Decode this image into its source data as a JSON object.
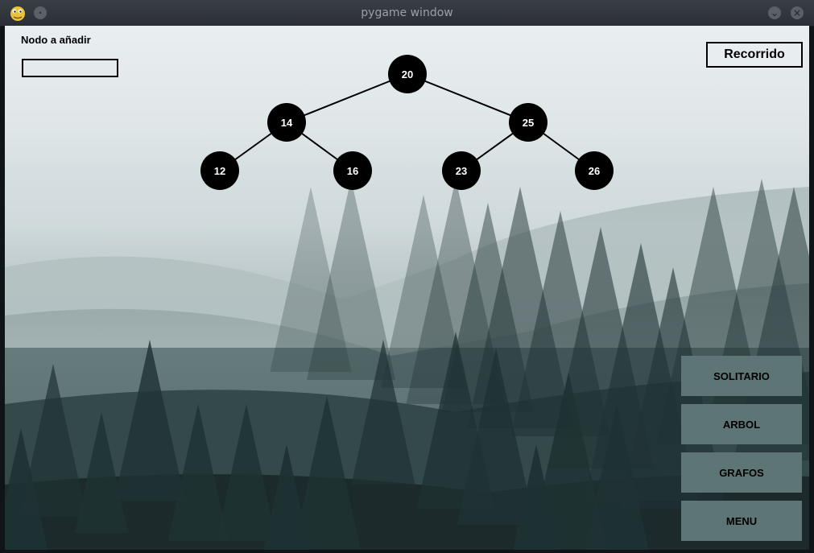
{
  "window": {
    "title": "pygame window"
  },
  "panel": {
    "node_label": "Nodo a añadir",
    "node_input_value": "",
    "traversal_button": "Recorrido"
  },
  "tree": {
    "nodes": [
      {
        "id": "n20",
        "value": "20"
      },
      {
        "id": "n14",
        "value": "14"
      },
      {
        "id": "n25",
        "value": "25"
      },
      {
        "id": "n12",
        "value": "12"
      },
      {
        "id": "n16",
        "value": "16"
      },
      {
        "id": "n23",
        "value": "23"
      },
      {
        "id": "n26",
        "value": "26"
      }
    ],
    "edges": [
      [
        "n20",
        "n14"
      ],
      [
        "n20",
        "n25"
      ],
      [
        "n14",
        "n12"
      ],
      [
        "n14",
        "n16"
      ],
      [
        "n25",
        "n23"
      ],
      [
        "n25",
        "n26"
      ]
    ]
  },
  "menu": {
    "solitario": "SOLITARIO",
    "arbol": "ARBOL",
    "grafos": "GRAFOS",
    "menu": "MENU"
  }
}
